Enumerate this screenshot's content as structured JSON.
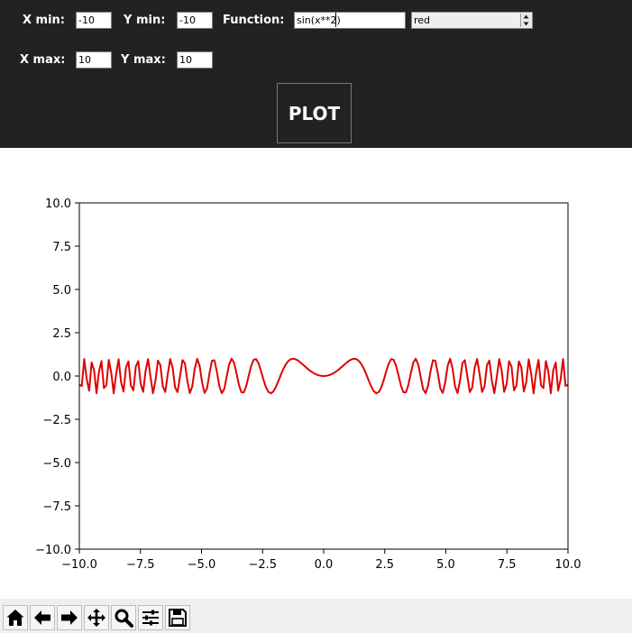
{
  "controls": {
    "xmin_label": "X min:",
    "xmin_value": "-10",
    "ymin_label": "Y min:",
    "ymin_value": "-10",
    "function_label": "Function:",
    "function_value": "sin(x**2)",
    "color_value": "red",
    "xmax_label": "X max:",
    "xmax_value": "10",
    "ymax_label": "Y max:",
    "ymax_value": "10",
    "plot_label": "PLOT"
  },
  "colors": {
    "panel_background": "#222220",
    "line": "#e00000"
  },
  "chart_data": {
    "type": "line",
    "function": "sin(x**2)",
    "line_color": "red",
    "xlim": [
      -10,
      10
    ],
    "ylim": [
      -10,
      10
    ],
    "x_ticks": [
      -10,
      -7.5,
      -5,
      -2.5,
      0,
      2.5,
      5,
      7.5,
      10
    ],
    "y_ticks": [
      -10,
      -7.5,
      -5,
      -2.5,
      0,
      2.5,
      5,
      7.5,
      10
    ],
    "x_tick_labels": [
      "−10.0",
      "−7.5",
      "−5.0",
      "−2.5",
      "0.0",
      "2.5",
      "5.0",
      "7.5",
      "10.0"
    ],
    "y_tick_labels": [
      "−10.0",
      "−7.5",
      "−5.0",
      "−2.5",
      "0.0",
      "2.5",
      "5.0",
      "7.5",
      "10.0"
    ],
    "sample_count": 200,
    "grid": false,
    "title": "",
    "xlabel": "",
    "ylabel": ""
  },
  "toolbar": {
    "items": [
      {
        "name": "home-icon",
        "icon": "home"
      },
      {
        "name": "back-arrow-icon",
        "icon": "back"
      },
      {
        "name": "forward-arrow-icon",
        "icon": "forward"
      },
      {
        "name": "pan-icon",
        "icon": "move"
      },
      {
        "name": "zoom-icon",
        "icon": "zoom"
      },
      {
        "name": "configure-subplots-icon",
        "icon": "sliders"
      },
      {
        "name": "save-icon",
        "icon": "save"
      }
    ]
  }
}
